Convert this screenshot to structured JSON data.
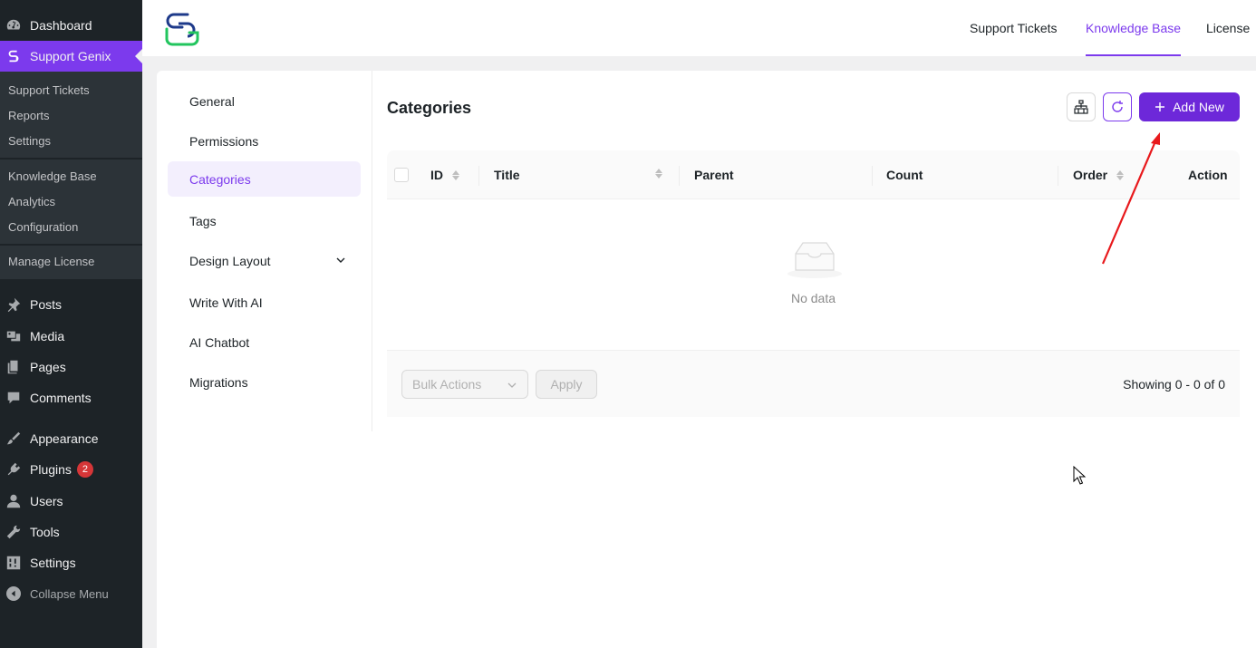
{
  "wp_menu": {
    "top_items": [
      {
        "label": "Dashboard",
        "icon": "dashboard-icon"
      },
      {
        "label": "Support Genix",
        "icon": "support-genix-icon"
      }
    ],
    "submenu": {
      "group1": [
        "Support Tickets",
        "Reports",
        "Settings"
      ],
      "group2": [
        "Knowledge Base",
        "Analytics",
        "Configuration"
      ],
      "group3": [
        "Manage License"
      ]
    },
    "items": [
      {
        "label": "Posts",
        "icon": "pin-icon"
      },
      {
        "label": "Media",
        "icon": "media-icon"
      },
      {
        "label": "Pages",
        "icon": "pages-icon"
      },
      {
        "label": "Comments",
        "icon": "comments-icon"
      },
      {
        "label": "Appearance",
        "icon": "brush-icon"
      },
      {
        "label": "Plugins",
        "icon": "plugin-icon",
        "badge": "2"
      },
      {
        "label": "Users",
        "icon": "user-icon"
      },
      {
        "label": "Tools",
        "icon": "wrench-icon"
      },
      {
        "label": "Settings",
        "icon": "settings-icon"
      }
    ],
    "collapse_label": "Collapse Menu"
  },
  "topbar": {
    "nav": [
      "Support Tickets",
      "Knowledge Base",
      "License"
    ],
    "active": "Knowledge Base"
  },
  "settings_nav": {
    "items": [
      "General",
      "Permissions",
      "Categories",
      "Tags",
      "Design Layout",
      "Write With AI",
      "AI Chatbot",
      "Migrations"
    ],
    "active": "Categories"
  },
  "page": {
    "title": "Categories",
    "add_new_label": "Add New",
    "table": {
      "columns": [
        "ID",
        "Title",
        "Parent",
        "Count",
        "Order",
        "Action"
      ],
      "empty_text": "No data"
    },
    "footer": {
      "bulk_placeholder": "Bulk Actions",
      "apply_label": "Apply",
      "showing": "Showing 0 - 0 of 0"
    }
  },
  "colors": {
    "accent": "#7c3aed",
    "wp_sidebar": "#1d2327",
    "annotation": "#e8191c"
  }
}
